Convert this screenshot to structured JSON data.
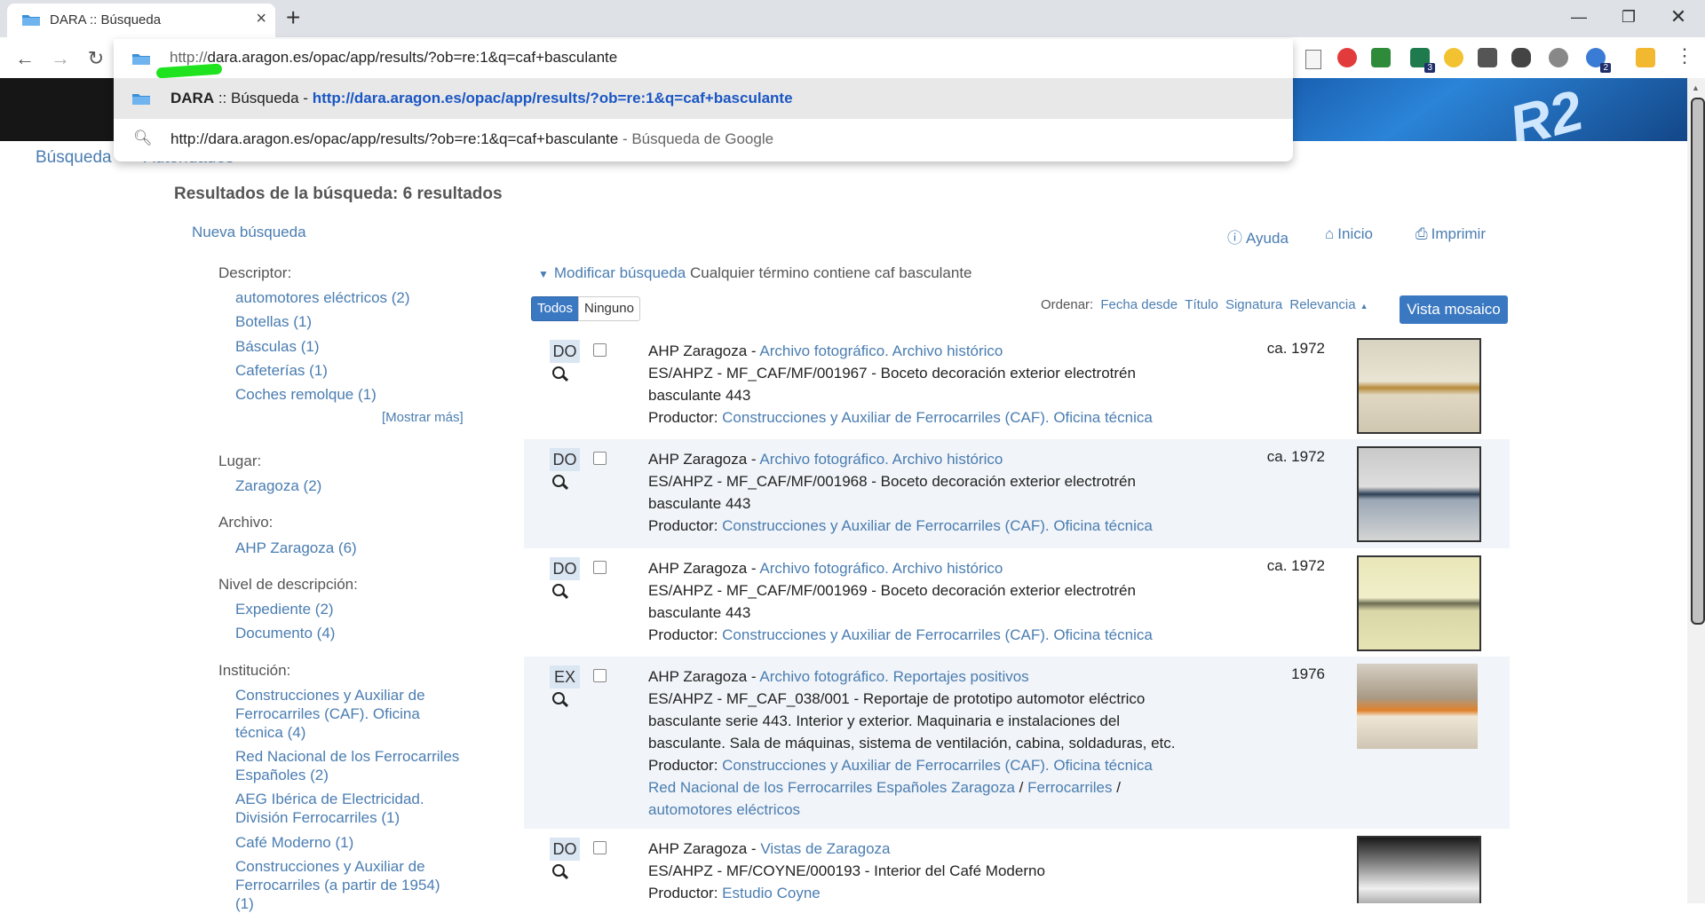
{
  "browser": {
    "tab_title": "DARA :: Búsqueda",
    "url_scheme": "http://",
    "url_rest": "dara.aragon.es/opac/app/results/?ob=re:1&q=caf+basculante",
    "suggestions": [
      {
        "title_strong": "DARA",
        "title_rest": " :: Búsqueda",
        "sep": " - ",
        "url": "http://dara.aragon.es/opac/app/results/?ob=re:1&q=caf+basculante"
      },
      {
        "text": "http://dara.aragon.es/opac/app/results/?ob=re:1&q=caf+basculante",
        "sep": " - ",
        "muted": "Búsqueda de Google"
      }
    ],
    "ext_badges": [
      "3",
      "2"
    ]
  },
  "nav": {
    "search": "Búsqueda",
    "authorities": "Autoridades"
  },
  "header": {
    "results_title": "Resultados de la búsqueda: 6 resultados",
    "new_search": "Nueva búsqueda",
    "help": "Ayuda",
    "home": "Inicio",
    "print": "Imprimir"
  },
  "facets": {
    "descriptor": {
      "label": "Descriptor:",
      "items": [
        "automotores eléctricos (2)",
        "Botellas (1)",
        "Básculas (1)",
        "Cafeterías (1)",
        "Coches remolque (1)"
      ],
      "more": "[Mostrar más]"
    },
    "lugar": {
      "label": "Lugar:",
      "items": [
        "Zaragoza (2)"
      ]
    },
    "archivo": {
      "label": "Archivo:",
      "items": [
        "AHP Zaragoza (6)"
      ]
    },
    "nivel": {
      "label": "Nivel de descripción:",
      "items": [
        "Expediente (2)",
        "Documento (4)"
      ]
    },
    "institucion": {
      "label": "Institución:",
      "items": [
        [
          "Construcciones y Auxiliar de",
          "Ferrocarriles (CAF). Oficina",
          "técnica (4)"
        ],
        [
          "Red Nacional de los Ferrocarriles",
          "Españoles (2)"
        ],
        [
          "AEG Ibérica de Electricidad.",
          "División Ferrocarriles (1)"
        ],
        [
          "Café Moderno (1)"
        ],
        [
          "Construcciones y Auxiliar de",
          "Ferrocarriles (a partir de 1954)",
          "(1)"
        ]
      ]
    }
  },
  "results_bar": {
    "modify": "Modificar búsqueda",
    "summary": " Cualquier término contiene caf basculante",
    "select_all": "Todos",
    "select_none": "Ninguno",
    "sort_label": "Ordenar:",
    "sort_options": [
      "Fecha desde",
      "Título",
      "Signatura",
      "Relevancia"
    ],
    "mosaic": "Vista mosaico"
  },
  "results": [
    {
      "level": "DO",
      "archive": "AHP Zaragoza",
      "sep": " - ",
      "fonds": "Archivo fotográfico. Archivo histórico",
      "lines": [
        "ES/AHPZ - MF_CAF/MF/001967 - Boceto decoración exterior electrotrén",
        "basculante 443"
      ],
      "producer_label": "Productor: ",
      "producer": "Construcciones y Auxiliar de Ferrocarriles (CAF). Oficina técnica",
      "date": "ca. 1972"
    },
    {
      "level": "DO",
      "archive": "AHP Zaragoza",
      "sep": " - ",
      "fonds": "Archivo fotográfico. Archivo histórico",
      "lines": [
        "ES/AHPZ - MF_CAF/MF/001968 - Boceto decoración exterior electrotrén",
        "basculante 443"
      ],
      "producer_label": "Productor: ",
      "producer": "Construcciones y Auxiliar de Ferrocarriles (CAF). Oficina técnica",
      "date": "ca. 1972"
    },
    {
      "level": "DO",
      "archive": "AHP Zaragoza",
      "sep": " - ",
      "fonds": "Archivo fotográfico. Archivo histórico",
      "lines": [
        "ES/AHPZ - MF_CAF/MF/001969 - Boceto decoración exterior electrotrén",
        "basculante 443"
      ],
      "producer_label": "Productor: ",
      "producer": "Construcciones y Auxiliar de Ferrocarriles (CAF). Oficina técnica",
      "date": "ca. 1972"
    },
    {
      "level": "EX",
      "archive": "AHP Zaragoza",
      "sep": " - ",
      "fonds": "Archivo fotográfico. Reportajes positivos",
      "lines": [
        "ES/AHPZ - MF_CAF_038/001 - Reportaje de prototipo automotor eléctrico",
        "basculante serie 443. Interior y exterior. Maquinaria e instalaciones del",
        "basculante. Sala de máquinas, sistema de ventilación, cabina, soldaduras, etc."
      ],
      "producer_label": "Productor: ",
      "producer": "Construcciones y Auxiliar de Ferrocarriles (CAF). Oficina técnica",
      "extra_links": [
        "Red Nacional de los Ferrocarriles Españoles Zaragoza",
        "Ferrocarriles",
        "automotores eléctricos"
      ],
      "slash": " / ",
      "date": "1976"
    },
    {
      "level": "DO",
      "archive": "AHP Zaragoza",
      "sep": " - ",
      "fonds": "Vistas de Zaragoza",
      "lines": [
        "ES/AHPZ - MF/COYNE/000193 - Interior del Café Moderno"
      ],
      "producer_label": "Productor: ",
      "producer": "Estudio Coyne",
      "date": ""
    }
  ]
}
